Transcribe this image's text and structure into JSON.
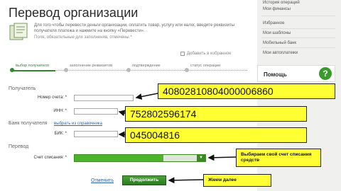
{
  "page": {
    "title": "Перевод организации",
    "intro": "Для того чтобы перевести деньги организации, оплатить товар, услугу или налог, введите реквизиты получателя платежа и нажмите на кнопку «Перевести».",
    "required_note": "Поля, обязательные для заполнения, отмечены *",
    "favorites_link": "Добавить в избранное"
  },
  "stepper": {
    "steps": [
      {
        "label": "выбор получателя",
        "active": true
      },
      {
        "label": "заполнение реквизитов",
        "active": false
      },
      {
        "label": "подтверждение",
        "active": false
      },
      {
        "label": "статус операции",
        "active": false
      }
    ]
  },
  "form": {
    "recipient_section": "Получатель",
    "account_label": "Номер счета: *",
    "inn_label": "ИНН: *",
    "bank_section": "Банк получателя",
    "bank_directory_link": "выбрать из справочника",
    "bik_label": "БИК: *",
    "transfer_section": "Перевод",
    "debit_account_label": "Счет списания: *",
    "cancel_label": "Отменить",
    "proceed_label": "Продолжить"
  },
  "sidebar": {
    "items": [
      "История операций",
      "Мои финансы",
      "Избранное",
      "Мои шаблоны",
      "Мобильный банк",
      "Мои автоплатежи"
    ],
    "help_label": "Помощь",
    "help_icon": "?"
  },
  "callouts": {
    "account_value": "40802810804000006860",
    "inn_value": "752802596174",
    "bik_value": "045004816",
    "debit_note": "Выбираем свой счет списания средств",
    "proceed_note": "Жмем далее"
  },
  "colors": {
    "accent_green": "#2f8a2f",
    "callout_yellow": "#ffff33",
    "link_blue": "#2e6aa8"
  }
}
